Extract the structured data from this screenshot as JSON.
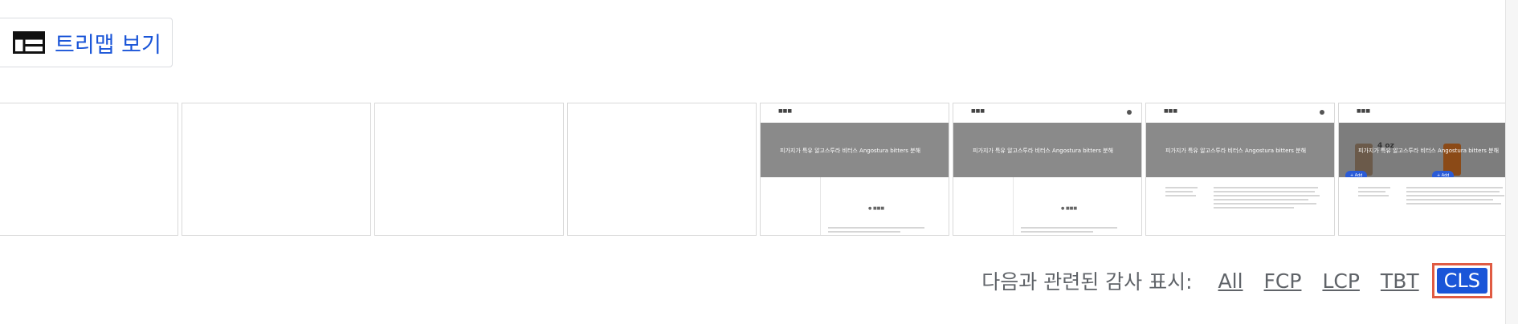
{
  "treemap": {
    "label": "트리맵 보기",
    "icon": "treemap-icon"
  },
  "filmstrip": {
    "frames": [
      {
        "blank": true
      },
      {
        "blank": true
      },
      {
        "blank": true
      },
      {
        "blank": true
      },
      {
        "blank": false,
        "title": "피가지가 특유 알고스투라 비터스 Angostura bitters 분해",
        "has_logo": true
      },
      {
        "blank": false,
        "title": "피가지가 특유 알고스투라 비터스 Angostura bitters 분해",
        "has_logo": true
      },
      {
        "blank": false,
        "title": "피가지가 특유 알고스투라 비터스 Angostura bitters 분해",
        "has_logo": false
      },
      {
        "blank": false,
        "title": "피가지가 특유 알고스투라 비터스 Angostura bitters 분해",
        "has_logo": false,
        "products": true,
        "oz": "4 oz",
        "add": "+ Add"
      }
    ]
  },
  "audit_filter": {
    "label": "다음과 관련된 감사 표시:",
    "options": [
      "All",
      "FCP",
      "LCP",
      "TBT"
    ],
    "active": "CLS"
  },
  "colors": {
    "link": "#1a55d8",
    "highlight": "#e05b43",
    "active_bg": "#1a55d8"
  }
}
